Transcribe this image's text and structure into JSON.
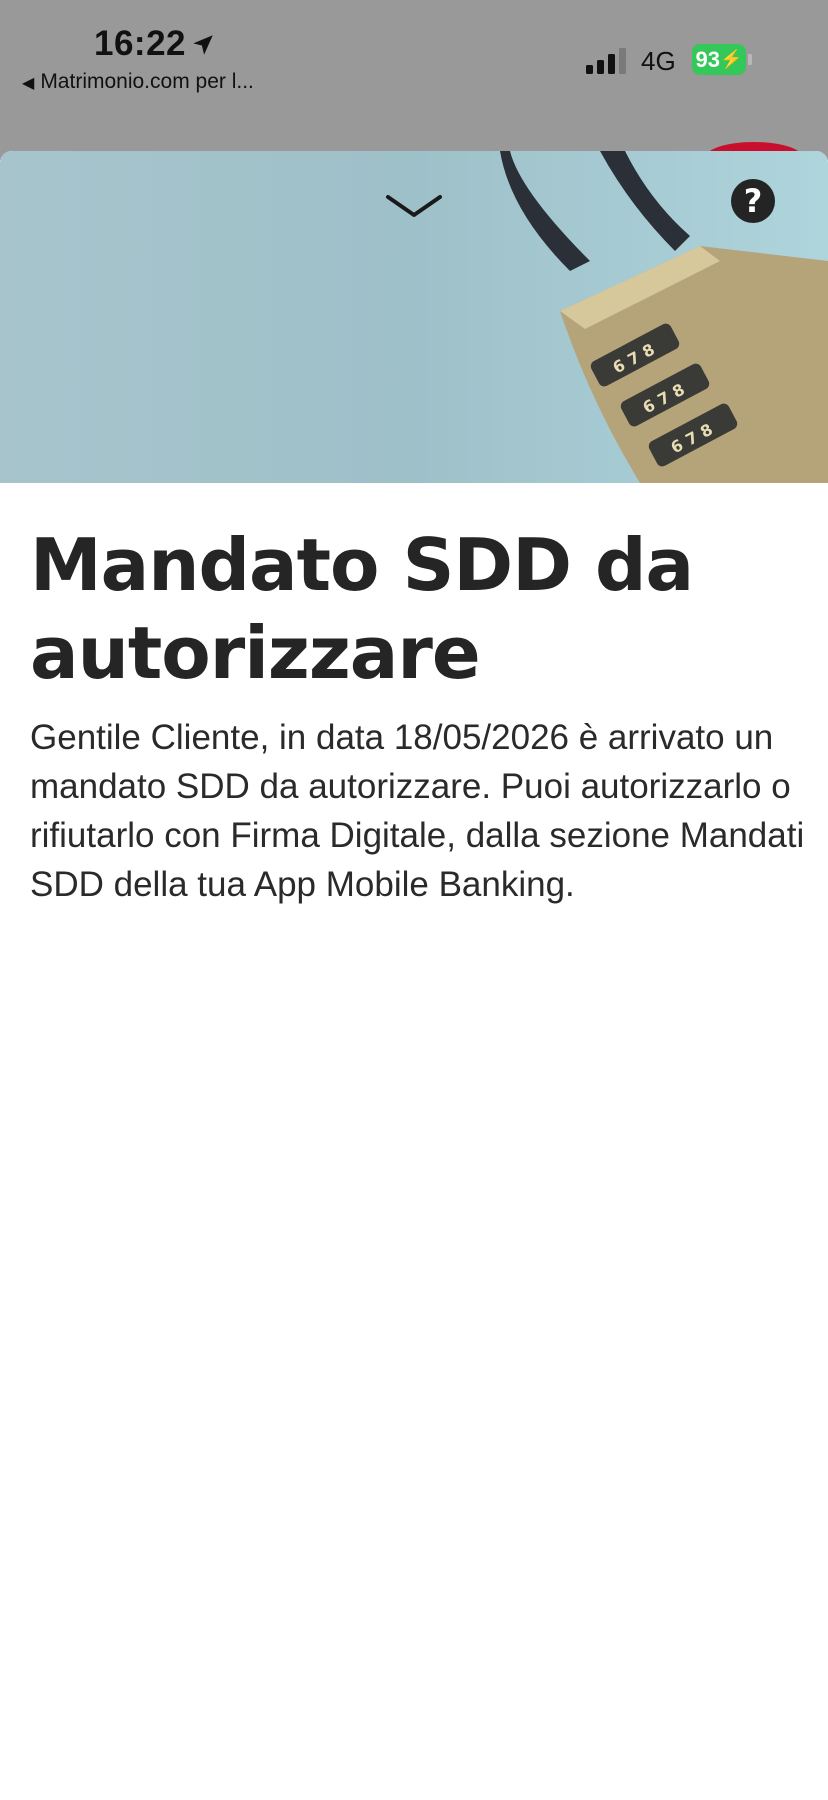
{
  "status_bar": {
    "time": "16:22",
    "back_app": "Matrimonio.com per l...",
    "network": "4G",
    "battery": "93",
    "icons": [
      "location-arrow-icon",
      "signal-bars-icon",
      "battery-charging-icon"
    ]
  },
  "sheet": {
    "dismiss_icon": "chevron-down-icon",
    "help_icon": "question-icon",
    "help_symbol": "?",
    "title": "Mandato SDD da autorizzare",
    "message": "Gentile Cliente, in data 18/05/2026 è arrivato un mandato SDD da autorizzare. Puoi autorizzarlo o rifiutarlo con Firma Digitale, dalla sezione Mandati SDD della tua App Mobile Banking."
  },
  "colors": {
    "dim_background": "#999999",
    "hero_background": "#a7c4cc",
    "battery_green": "#34c759",
    "text_dark": "#252525"
  }
}
